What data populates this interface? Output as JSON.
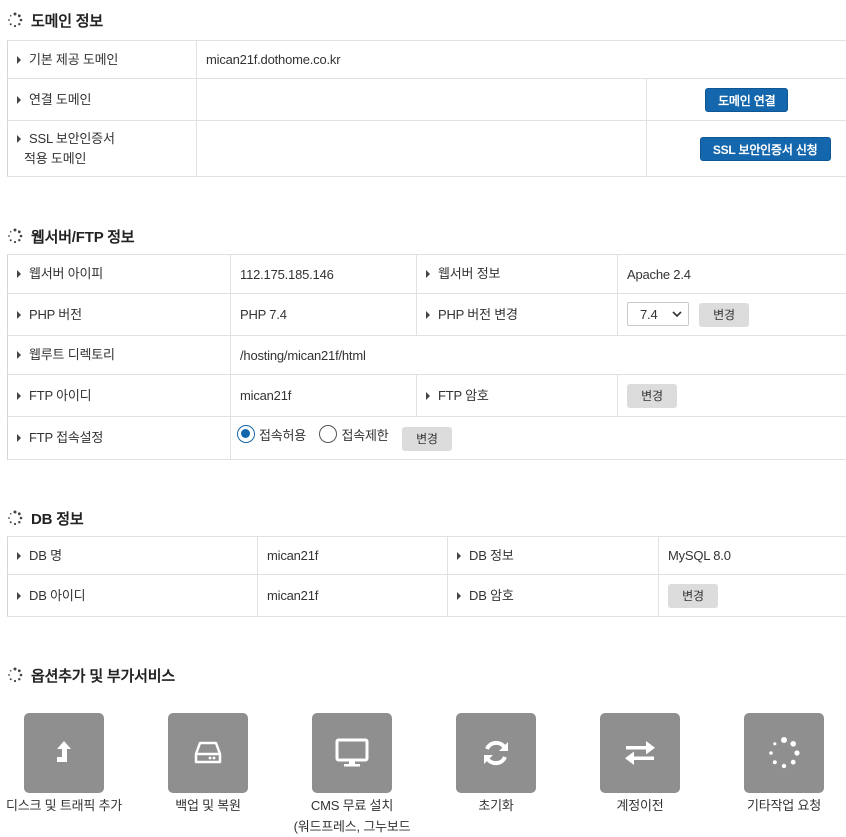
{
  "domain_section": {
    "title": "도메인 정보",
    "rows": {
      "basic_label": "기본 제공 도메인",
      "basic_value": "mican21f.dothome.co.kr",
      "connected_label": "연결 도메인",
      "connect_button": "도메인 연결",
      "ssl_label_line1": "SSL 보안인증서",
      "ssl_label_line2": "적용 도메인",
      "ssl_button": "SSL 보안인증서 신청"
    }
  },
  "web_section": {
    "title": "웹서버/FTP 정보",
    "ip_label": "웹서버 아이피",
    "ip_value": "112.175.185.146",
    "server_label": "웹서버 정보",
    "server_value": "Apache 2.4",
    "php_label": "PHP 버전",
    "php_value": "PHP 7.4",
    "php_change_label": "PHP 버전 변경",
    "php_select_value": "7.4",
    "php_change_button": "변경",
    "webroot_label": "웹루트 디렉토리",
    "webroot_value": "/hosting/mican21f/html",
    "ftp_id_label": "FTP 아이디",
    "ftp_id_value": "mican21f",
    "ftp_pw_label": "FTP 암호",
    "ftp_pw_button": "변경",
    "ftp_access_label": "FTP 접속설정",
    "ftp_allow_label": "접속허용",
    "ftp_deny_label": "접속제한",
    "ftp_access_button": "변경"
  },
  "db_section": {
    "title": "DB 정보",
    "name_label": "DB 명",
    "name_value": "mican21f",
    "info_label": "DB 정보",
    "info_value": "MySQL 8.0",
    "id_label": "DB 아이디",
    "id_value": "mican21f",
    "pw_label": "DB 암호",
    "pw_button": "변경"
  },
  "options_section": {
    "title": "옵션추가 및 부가서비스",
    "tiles": [
      {
        "label": "디스크 및 트래픽 추가",
        "icon": "upload-arrow-icon"
      },
      {
        "label": "백업 및 복원",
        "icon": "hard-drive-icon"
      },
      {
        "label": "CMS 무료 설치",
        "label_line2": "(워드프레스, 그누보드",
        "icon": "monitor-icon"
      },
      {
        "label": "초기화",
        "icon": "refresh-icon"
      },
      {
        "label": "계정이전",
        "icon": "transfer-arrows-icon"
      },
      {
        "label": "기타작업 요청",
        "icon": "spinner-icon"
      }
    ]
  },
  "colors": {
    "primary_button": "#1467ad",
    "accent_text": "#e02020",
    "tile_bg": "#8f8f8f"
  }
}
